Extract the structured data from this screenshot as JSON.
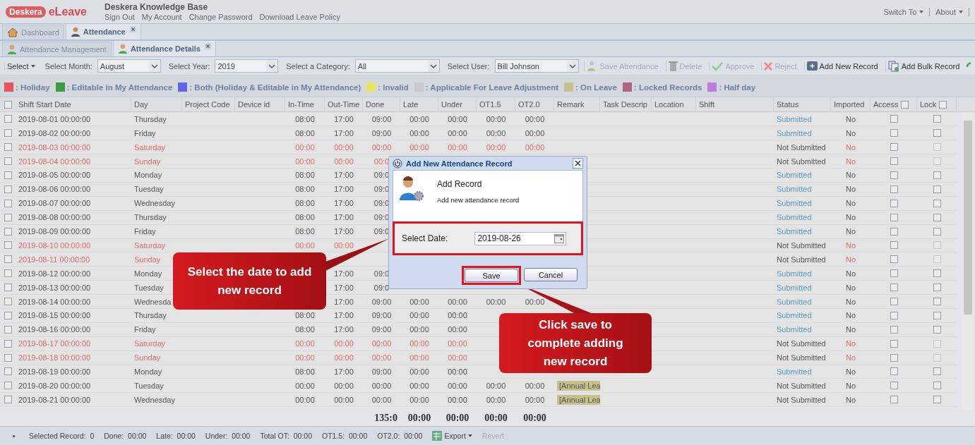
{
  "header": {
    "logo_mark": "Deskera",
    "logo_text": "eLeave",
    "title": "Deskera Knowledge Base",
    "links": [
      "Sign Out",
      "My Account",
      "Change Password",
      "Download Leave Policy"
    ],
    "menus": [
      "Switch To",
      "About"
    ]
  },
  "main_tabs": [
    {
      "label": "Dashboard",
      "selected": false,
      "closable": false
    },
    {
      "label": "Attendance",
      "selected": true,
      "closable": true
    }
  ],
  "sub_tabs": [
    {
      "label": "Attendance Management",
      "selected": false,
      "closable": false
    },
    {
      "label": "Attendance Details",
      "selected": true,
      "closable": true
    }
  ],
  "toolbar": [
    {
      "kind": "menu",
      "label": "Select"
    },
    {
      "kind": "combo",
      "label": "Select Month:",
      "value": "August",
      "wide": false
    },
    {
      "kind": "combo",
      "label": "Select Year:",
      "value": "2019",
      "wide": false
    },
    {
      "kind": "combo",
      "label": "Select a Category:",
      "value": "All",
      "wide": true
    },
    {
      "kind": "combo",
      "label": "Select User:",
      "value": "Bill Johnson",
      "wide": true
    },
    {
      "kind": "button",
      "label": "Save Attendance",
      "disabled": true
    },
    {
      "kind": "button",
      "label": "Delete",
      "disabled": true
    },
    {
      "kind": "button",
      "label": "Approve",
      "disabled": true
    },
    {
      "kind": "button",
      "label": "Reject",
      "disabled": true
    },
    {
      "kind": "button",
      "label": "Add New Record",
      "disabled": false
    },
    {
      "kind": "button",
      "label": "Add Bulk Record",
      "disabled": false
    }
  ],
  "legend": [
    {
      "label": ": Holiday",
      "color": "#e8545b"
    },
    {
      "label": ": Editable in My Attendance",
      "color": "#3f9a44"
    },
    {
      "label": ": Both (Holiday & Editable in My Attendance)",
      "color": "#6464e6"
    },
    {
      "label": ": Invalid",
      "color": "#e6e65a"
    },
    {
      "label": ": Applicable For Leave Adjustment",
      "color": "#c9c9c9"
    },
    {
      "label": ": On Leave",
      "color": "#c8c08c"
    },
    {
      "label": ": Locked Records",
      "color": "#b06482"
    },
    {
      "label": ": Half day",
      "color": "#c07ae0"
    }
  ],
  "table": {
    "columns": [
      "Shift Start Date",
      "Day",
      "Project Code",
      "Device id",
      "In-Time",
      "Out-Time",
      "Done",
      "Late",
      "Under",
      "OT1.5",
      "OT2.0",
      "Remark",
      "Task Descrip",
      "Location",
      "Shift",
      "Status",
      "Imported",
      "Access",
      "Lock"
    ],
    "header_checks": {
      "select_all": false,
      "access": false,
      "lock": false
    },
    "rows": [
      {
        "date": "2019-08-01 00:00:00",
        "day": "Thursday",
        "in": "08:00",
        "out": "17:00",
        "done": "09:00",
        "late": "00:00",
        "under": "00:00",
        "ot15": "00:00",
        "ot20": "00:00",
        "status": "Submitted",
        "imported": "No",
        "holiday": false,
        "submitted": true,
        "selected": false,
        "access": false,
        "lock": false,
        "lock_disabled": false
      },
      {
        "date": "2019-08-02 00:00:00",
        "day": "Friday",
        "in": "08:00",
        "out": "17:00",
        "done": "09:00",
        "late": "00:00",
        "under": "00:00",
        "ot15": "00:00",
        "ot20": "00:00",
        "status": "Submitted",
        "imported": "No",
        "holiday": false,
        "submitted": true,
        "selected": false,
        "access": false,
        "lock": false,
        "lock_disabled": false
      },
      {
        "date": "2019-08-03 00:00:00",
        "day": "Saturday",
        "in": "00:00",
        "out": "00:00",
        "done": "00:00",
        "late": "00:00",
        "under": "00:00",
        "ot15": "00:00",
        "ot20": "00:00",
        "status": "Not Submitted",
        "imported": "No",
        "holiday": true,
        "submitted": false,
        "selected": false,
        "access": false,
        "lock": false,
        "lock_disabled": true
      },
      {
        "date": "2019-08-04 00:00:00",
        "day": "Sunday",
        "in": "00:00",
        "out": "00:00",
        "done": "00:0",
        "status": "Not Submitted",
        "imported": "No",
        "holiday": true,
        "submitted": false,
        "selected": false,
        "access": false,
        "lock": false,
        "lock_disabled": true
      },
      {
        "date": "2019-08-05 00:00:00",
        "day": "Monday",
        "in": "08:00",
        "out": "17:00",
        "done": "09:0",
        "status": "Submitted",
        "imported": "No",
        "holiday": false,
        "submitted": true,
        "selected": false,
        "access": false,
        "lock": false,
        "lock_disabled": false
      },
      {
        "date": "2019-08-06 00:00:00",
        "day": "Tuesday",
        "in": "08:00",
        "out": "17:00",
        "done": "09:0",
        "status": "Submitted",
        "imported": "No",
        "holiday": false,
        "submitted": true,
        "selected": false,
        "access": false,
        "lock": false,
        "lock_disabled": false
      },
      {
        "date": "2019-08-07 00:00:00",
        "day": "Wednesday",
        "in": "08:00",
        "out": "17:00",
        "done": "09:0",
        "status": "Submitted",
        "imported": "No",
        "holiday": false,
        "submitted": true,
        "selected": false,
        "access": false,
        "lock": false,
        "lock_disabled": false
      },
      {
        "date": "2019-08-08 00:00:00",
        "day": "Thursday",
        "in": "08:00",
        "out": "17:00",
        "done": "09:0",
        "status": "Submitted",
        "imported": "No",
        "holiday": false,
        "submitted": true,
        "selected": false,
        "access": false,
        "lock": false,
        "lock_disabled": false
      },
      {
        "date": "2019-08-09 00:00:00",
        "day": "Friday",
        "in": "08:00",
        "out": "17:00",
        "done": "09:0",
        "status": "Submitted",
        "imported": "No",
        "holiday": false,
        "submitted": true,
        "selected": false,
        "access": false,
        "lock": false,
        "lock_disabled": false
      },
      {
        "date": "2019-08-10 00:00:00",
        "day": "Saturday",
        "in": "00:00",
        "out": "00:00",
        "status": "Not Submitted",
        "imported": "No",
        "holiday": true,
        "submitted": false,
        "selected": false,
        "access": false,
        "lock": false,
        "lock_disabled": true
      },
      {
        "date": "2019-08-11 00:00:00",
        "day": "Sunday",
        "status": "Not Submitted",
        "imported": "No",
        "holiday": true,
        "submitted": false,
        "selected": false,
        "access": false,
        "lock": false,
        "lock_disabled": true
      },
      {
        "date": "2019-08-12 00:00:00",
        "day": "Monday",
        "out": "17:00",
        "done": "09:0",
        "status": "Submitted",
        "imported": "No",
        "holiday": false,
        "submitted": true,
        "selected": false,
        "access": false,
        "lock": false,
        "lock_disabled": false
      },
      {
        "date": "2019-08-13 00:00:00",
        "day": "Tuesday",
        "out": "17:00",
        "done": "09:0",
        "status": "Submitted",
        "imported": "No",
        "holiday": false,
        "submitted": true,
        "selected": false,
        "access": false,
        "lock": false,
        "lock_disabled": false
      },
      {
        "date": "2019-08-14 00:00:00",
        "day": "Wednesda",
        "out": "17:00",
        "done": "09:00",
        "late": "00:00",
        "under": "00:00",
        "ot15": "00:00",
        "ot20": "00:00",
        "status": "Submitted",
        "imported": "No",
        "holiday": false,
        "submitted": true,
        "selected": false,
        "access": false,
        "lock": false,
        "lock_disabled": false
      },
      {
        "date": "2019-08-15 00:00:00",
        "day": "Thursday",
        "in": "08:00",
        "out": "17:00",
        "done": "09:00",
        "late": "00:00",
        "under": "00:00",
        "status": "Submitted",
        "imported": "No",
        "holiday": false,
        "submitted": true,
        "selected": false,
        "access": false,
        "lock": false,
        "lock_disabled": false
      },
      {
        "date": "2019-08-16 00:00:00",
        "day": "Friday",
        "in": "08:00",
        "out": "17:00",
        "done": "09:00",
        "late": "00:00",
        "under": "00:00",
        "status": "Submitted",
        "imported": "No",
        "holiday": false,
        "submitted": true,
        "selected": false,
        "access": false,
        "lock": false,
        "lock_disabled": false
      },
      {
        "date": "2019-08-17 00:00:00",
        "day": "Saturday",
        "in": "00:00",
        "out": "00:00",
        "done": "00:00",
        "late": "00:00",
        "under": "00:00",
        "status": "Not Submitted",
        "imported": "No",
        "holiday": true,
        "submitted": false,
        "selected": false,
        "access": false,
        "lock": false,
        "lock_disabled": true
      },
      {
        "date": "2019-08-18 00:00:00",
        "day": "Sunday",
        "in": "00:00",
        "out": "00:00",
        "done": "00:00",
        "late": "00:00",
        "under": "00:00",
        "status": "Not Submitted",
        "imported": "No",
        "holiday": true,
        "submitted": false,
        "selected": false,
        "access": false,
        "lock": false,
        "lock_disabled": true
      },
      {
        "date": "2019-08-19 00:00:00",
        "day": "Monday",
        "in": "08:00",
        "out": "17:00",
        "done": "09:00",
        "late": "00:00",
        "under": "00:00",
        "status": "Submitted",
        "imported": "No",
        "holiday": false,
        "submitted": true,
        "selected": false,
        "access": false,
        "lock": false,
        "lock_disabled": false
      },
      {
        "date": "2019-08-20 00:00:00",
        "day": "Tuesday",
        "in": "00:00",
        "out": "00:00",
        "done": "00:00",
        "late": "00:00",
        "under": "00:00",
        "ot15": "00:00",
        "ot20": "00:00",
        "remark": "[Annual Lea",
        "status": "Not Submitted",
        "imported": "No",
        "holiday": false,
        "submitted": false,
        "selected": false,
        "access": false,
        "lock": false,
        "lock_disabled": false
      },
      {
        "date": "2019-08-21 00:00:00",
        "day": "Wednesday",
        "in": "00:00",
        "out": "00:00",
        "done": "00:00",
        "late": "00:00",
        "under": "00:00",
        "ot15": "00:00",
        "ot20": "00:00",
        "remark": "[Annual Lea",
        "status": "Not Submitted",
        "imported": "No",
        "holiday": false,
        "submitted": false,
        "selected": false,
        "access": false,
        "lock": false,
        "lock_disabled": false
      }
    ],
    "totals": {
      "done": "135:0",
      "late": "00:00",
      "under": "00:00",
      "ot15": "00:00",
      "ot20": "00:00"
    }
  },
  "status_bar": {
    "items": [
      {
        "label": "Selected Record:",
        "value": "0"
      },
      {
        "label": "Done:",
        "value": "00:00"
      },
      {
        "label": "Late:",
        "value": "00:00"
      },
      {
        "label": "Under:",
        "value": "00:00"
      },
      {
        "label": "Total OT:",
        "value": "00:00"
      },
      {
        "label": "OT1.5:",
        "value": "00:00"
      },
      {
        "label": "OT2.0:",
        "value": "00:00"
      }
    ],
    "export": "Export",
    "revert": {
      "label": "Revert",
      "disabled": true
    }
  },
  "dialog": {
    "title": "Add New Attendance Record",
    "heading": "Add Record",
    "subtitle": "Add new attendance record",
    "field_label": "Select Date:",
    "field_value": "2019-08-26",
    "buttons": [
      "Save",
      "Cancel"
    ]
  },
  "callouts": [
    {
      "text": "Select the date to add new record"
    },
    {
      "text": "Click save to complete adding new record"
    }
  ]
}
